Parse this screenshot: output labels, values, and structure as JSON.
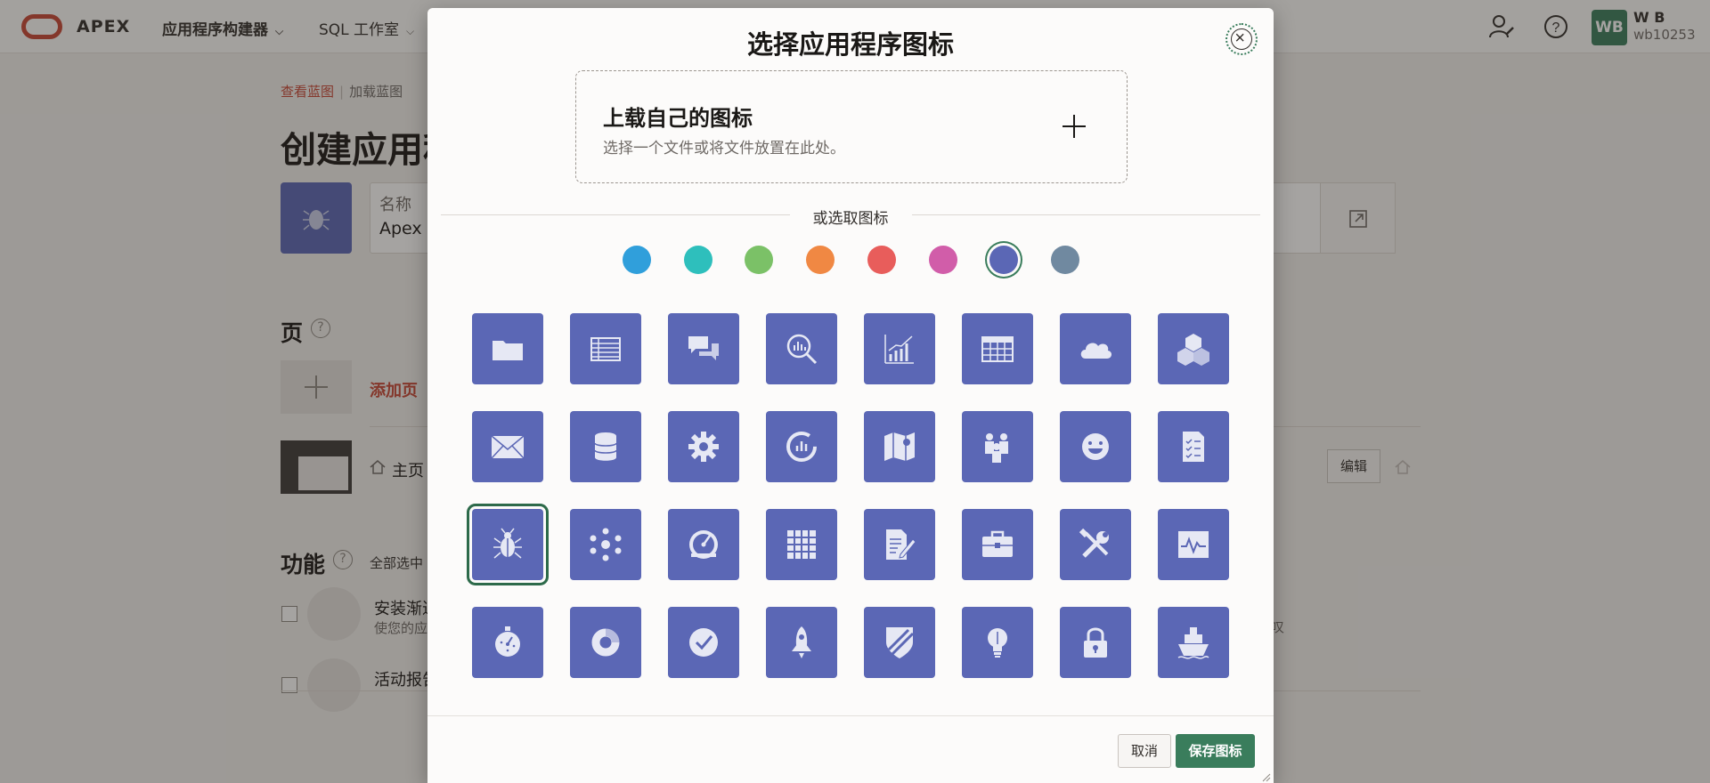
{
  "header": {
    "brand": "APEX",
    "nav": [
      {
        "label": "应用程序构建器"
      },
      {
        "label": "SQL 工作室"
      }
    ],
    "user": {
      "initials": "WB",
      "name": "W B",
      "id": "wb10253"
    }
  },
  "breadcrumb": {
    "items": [
      "查看蓝图",
      "加载蓝图"
    ]
  },
  "page": {
    "title": "创建应用程",
    "name_field": {
      "label": "名称",
      "value": "Apex I"
    },
    "pages_section": {
      "title": "页",
      "add_label": "添加页",
      "home_label": "主页",
      "edit_label": "编辑"
    },
    "features_section": {
      "title": "功能",
      "select_all": "全部选中",
      "items": [
        {
          "title": "安装渐进",
          "desc": "使您的应"
        },
        {
          "title": "活动报告",
          "desc": ""
        }
      ],
      "side_text": "叹"
    }
  },
  "dialog": {
    "title": "选择应用程序图标",
    "upload": {
      "title": "上载自己的图标",
      "subtitle": "选择一个文件或将文件放置在此处。"
    },
    "or_label": "或选取图标",
    "colors": [
      "#309fdb",
      "#2ebfbc",
      "#7bc167",
      "#f08843",
      "#e85d5b",
      "#d15da9",
      "#5b67b5",
      "#7089a0"
    ],
    "selected_color": "#5b67b5",
    "icons": [
      [
        "folder-icon",
        "table-icon",
        "chat-icon",
        "search-chart-icon",
        "line-chart-icon",
        "calendar-icon",
        "cloud-icon",
        "cubes-icon"
      ],
      [
        "mail-icon",
        "database-icon",
        "gear-icon",
        "gauge-chart-icon",
        "map-icon",
        "people-icon",
        "smiley-icon",
        "checklist-icon"
      ],
      [
        "bug-icon",
        "network-icon",
        "speedometer-icon",
        "grid-icon",
        "edit-document-icon",
        "briefcase-icon",
        "tools-icon",
        "pulse-icon"
      ],
      [
        "stopwatch-icon",
        "donut-chart-icon",
        "check-circle-icon",
        "rocket-icon",
        "shield-icon",
        "lightbulb-icon",
        "lock-icon",
        "ship-icon"
      ]
    ],
    "selected_icon": "bug-icon",
    "cancel_label": "取消",
    "save_label": "保存图标"
  }
}
